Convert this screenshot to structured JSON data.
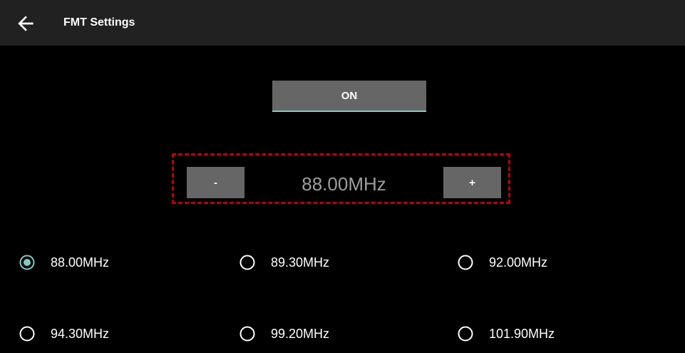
{
  "header": {
    "back_icon": "arrow-left-icon",
    "title": "FMT Settings"
  },
  "transmitter": {
    "toggle_label": "ON",
    "accent_color": "#80cbc4"
  },
  "frequency_stepper": {
    "minus_label": "-",
    "plus_label": "+",
    "value": "88.00MHz",
    "highlight_color": "#c00000"
  },
  "presets": {
    "selected_index": 0,
    "items": [
      {
        "label": "88.00MHz",
        "selected": true
      },
      {
        "label": "89.30MHz",
        "selected": false
      },
      {
        "label": "92.00MHz",
        "selected": false
      },
      {
        "label": "94.30MHz",
        "selected": false
      },
      {
        "label": "99.20MHz",
        "selected": false
      },
      {
        "label": "101.90MHz",
        "selected": false
      }
    ]
  }
}
